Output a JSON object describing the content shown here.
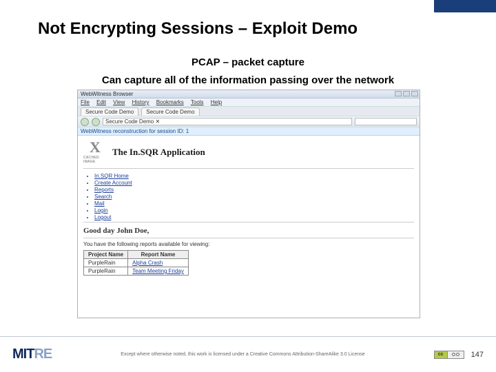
{
  "slide": {
    "title": "Not Encrypting Sessions – Exploit Demo",
    "subtitle1": "PCAP – packet capture",
    "subtitle2": "Can capture all of the information passing over the network"
  },
  "browser": {
    "window_title": "WebWitness Browser",
    "menu": [
      "File",
      "Edit",
      "View",
      "History",
      "Bookmarks",
      "Tools",
      "Help"
    ],
    "tabs": [
      "Secure Code Demo",
      "Secure Code Demo"
    ],
    "address": "Secure Code Demo ✕",
    "session_banner": "WebWitness reconstruction for session ID: 1"
  },
  "app": {
    "cached_label": "CACHED IMAGE",
    "cached_x": "X",
    "title": "The In.SQR Application",
    "nav_links": [
      "In.SQR Home",
      "Create Account",
      "Reports",
      "Search",
      "Mail",
      "Login",
      "Logout"
    ],
    "greeting": "Good day John Doe,",
    "subtext": "You have the following reports available for viewing:",
    "table": {
      "headers": [
        "Project Name",
        "Report Name"
      ],
      "rows": [
        [
          "PurpleRain",
          "Alpha Crash"
        ],
        [
          "PurpleRain",
          "Team Meeting Friday"
        ]
      ]
    }
  },
  "footer": {
    "logo_main": "MIT",
    "logo_fade": "RE",
    "license": "Except where otherwise noted, this work is licensed under a Creative Commons Attribution-ShareAlike 3.0 License",
    "cc_left": "cc",
    "page_number": "147"
  }
}
